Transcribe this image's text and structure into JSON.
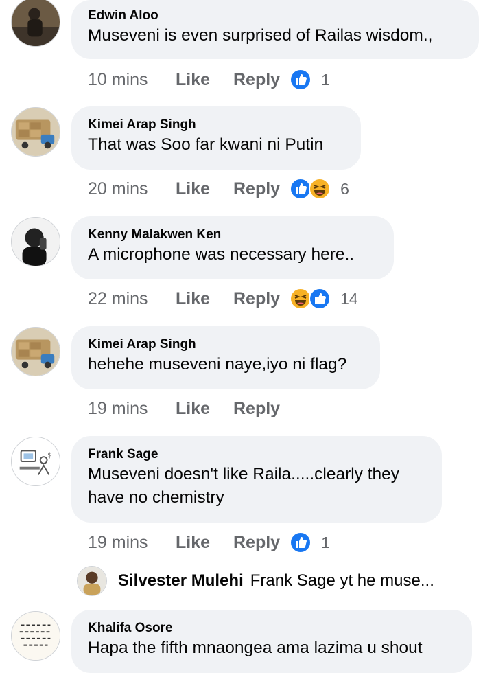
{
  "comments": [
    {
      "name": "Edwin Aloo",
      "text": "Museveni is even surprised of Railas wisdom.,",
      "time": "10 mins",
      "like": "Like",
      "reply": "Reply",
      "reactions": [
        "like"
      ],
      "count": "1"
    },
    {
      "name": "Kimei Arap Singh",
      "text": "That was Soo far kwani ni Putin",
      "time": "20 mins",
      "like": "Like",
      "reply": "Reply",
      "reactions": [
        "like",
        "haha"
      ],
      "count": "6"
    },
    {
      "name": "Kenny Malakwen Ken",
      "text": "A microphone was necessary here..",
      "time": "22 mins",
      "like": "Like",
      "reply": "Reply",
      "reactions": [
        "haha",
        "like"
      ],
      "count": "14"
    },
    {
      "name": "Kimei Arap Singh",
      "text": "hehehe museveni naye,iyo ni flag?",
      "time": "19 mins",
      "like": "Like",
      "reply": "Reply",
      "reactions": [],
      "count": ""
    },
    {
      "name": "Frank Sage",
      "text": "Museveni doesn't like Raila.....clearly they have no chemistry",
      "time": "19 mins",
      "like": "Like",
      "reply": "Reply",
      "reactions": [
        "like"
      ],
      "count": "1"
    },
    {
      "name": "Khalifa Osore",
      "text": "Hapa the fifth mnaongea ama lazima u shout"
    }
  ],
  "reply_preview": {
    "name": "Silvester Mulehi",
    "text": "Frank Sage yt he muse..."
  },
  "colors": {
    "like_blue": "#1877f2",
    "haha_yellow": "#f7b125",
    "bubble": "#f0f2f5",
    "muted": "#65676b"
  }
}
